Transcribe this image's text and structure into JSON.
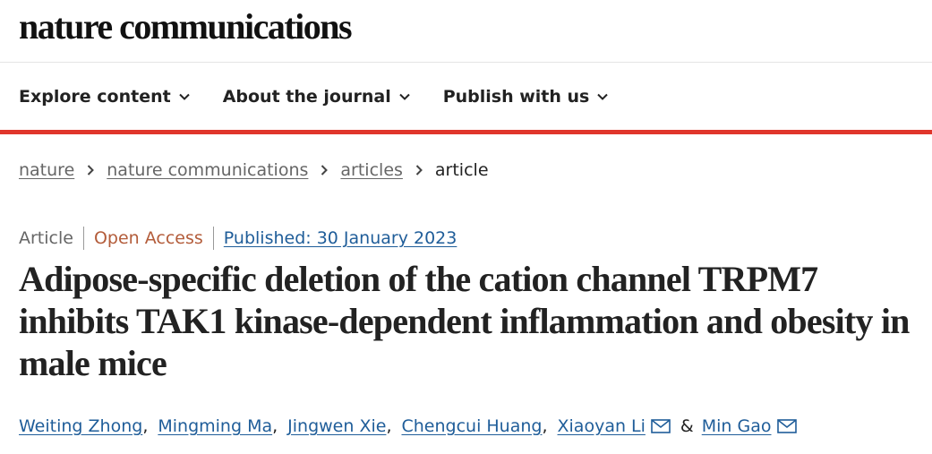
{
  "header": {
    "logo_text": "nature communications",
    "nav": [
      {
        "label": "Explore content"
      },
      {
        "label": "About the journal"
      },
      {
        "label": "Publish with us"
      }
    ],
    "accent_color": "#e0362c"
  },
  "breadcrumb": {
    "items": [
      "nature",
      "nature communications",
      "articles",
      "article"
    ]
  },
  "article": {
    "type": "Article",
    "access": "Open Access",
    "published": "Published: 30 January 2023",
    "title": "Adipose-specific deletion of the cation channel TRPM7 inhibits TAK1 kinase-dependent inflammation and obesity in male mice",
    "authors": [
      {
        "name": "Weiting Zhong",
        "separator": ","
      },
      {
        "name": "Mingming Ma",
        "separator": ","
      },
      {
        "name": "Jingwen Xie",
        "separator": ","
      },
      {
        "name": "Chengcui Huang",
        "separator": ","
      },
      {
        "name": "Xiaoyan Li",
        "icon": "mail-icon"
      },
      {
        "name": "Min Gao",
        "icon": "mail-icon"
      }
    ],
    "author_conjunction": "&"
  }
}
